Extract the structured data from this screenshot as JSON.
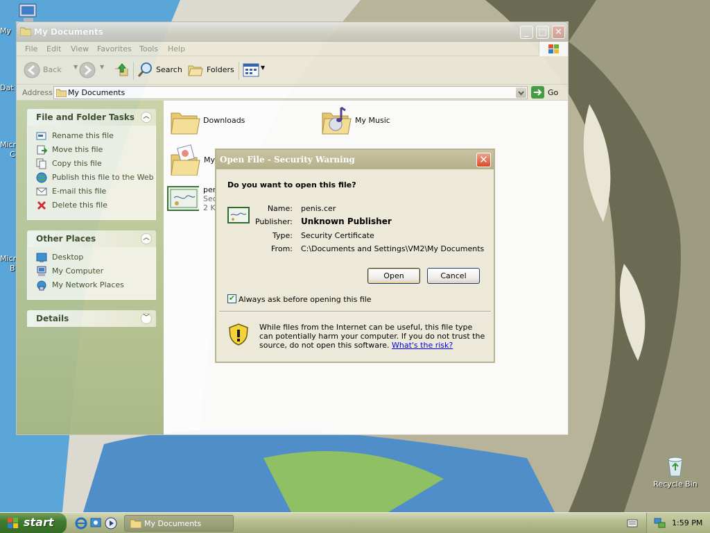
{
  "desktop": {
    "icons": [
      {
        "label": "Recycle Bin"
      }
    ],
    "clipped_labels": [
      "My",
      "Dat",
      "Micro",
      "C",
      "Micro",
      "B"
    ]
  },
  "explorer": {
    "title": "My Documents",
    "menu": [
      "File",
      "Edit",
      "View",
      "Favorites",
      "Tools",
      "Help"
    ],
    "toolbar": {
      "back": "Back",
      "search": "Search",
      "folders": "Folders"
    },
    "address": {
      "label": "Address",
      "value": "My Documents",
      "go": "Go"
    },
    "tasks_panel": {
      "title": "File and Folder Tasks",
      "items": [
        {
          "label": "Rename this file",
          "icon": "rename-icon"
        },
        {
          "label": "Move this file",
          "icon": "move-icon"
        },
        {
          "label": "Copy this file",
          "icon": "copy-icon"
        },
        {
          "label": "Publish this file to the Web",
          "icon": "globe-icon"
        },
        {
          "label": "E-mail this file",
          "icon": "email-icon"
        },
        {
          "label": "Delete this file",
          "icon": "delete-icon"
        }
      ]
    },
    "places_panel": {
      "title": "Other Places",
      "items": [
        {
          "label": "Desktop",
          "icon": "desktop-icon"
        },
        {
          "label": "My Computer",
          "icon": "computer-icon"
        },
        {
          "label": "My Network Places",
          "icon": "network-icon"
        }
      ]
    },
    "details_panel": {
      "title": "Details"
    },
    "files": [
      {
        "name": "Downloads",
        "icon": "folder-icon"
      },
      {
        "name": "My Music",
        "icon": "music-folder-icon"
      },
      {
        "name": "My",
        "icon": "pictures-folder-icon"
      },
      {
        "name_lines": [
          "per",
          "Sec",
          "2 KI"
        ],
        "icon": "certificate-icon"
      }
    ]
  },
  "dialog": {
    "title": "Open File - Security Warning",
    "question": "Do you want to open this file?",
    "fields": {
      "name_label": "Name:",
      "name_value": "penis.cer",
      "publisher_label": "Publisher:",
      "publisher_value": "Unknown Publisher",
      "type_label": "Type:",
      "type_value": "Security Certificate",
      "from_label": "From:",
      "from_value": "C:\\Documents and Settings\\VM2\\My Documents"
    },
    "open_button": "Open",
    "cancel_button": "Cancel",
    "always_ask_label": "Always ask before opening this file",
    "always_ask_checked": true,
    "warning_text": "While files from the Internet can be useful, this file type can potentially harm your computer. If you do not trust the source, do not open this software.",
    "risk_link": "What's the risk?"
  },
  "taskbar": {
    "start_label": "start",
    "window_button": "My Documents",
    "clock": "1:59 PM"
  }
}
